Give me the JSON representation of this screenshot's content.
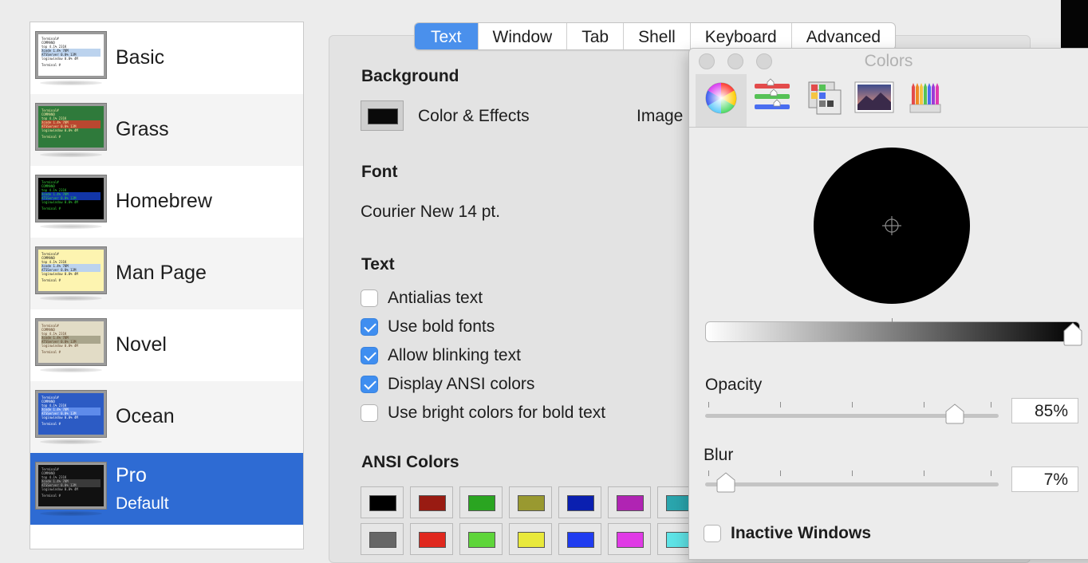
{
  "profiles": [
    {
      "name": "Basic",
      "sub": "",
      "thumb_bg": "#ffffff",
      "thumb_fg": "#222222",
      "band": "#bcd3ee",
      "band2": "#ffffff"
    },
    {
      "name": "Grass",
      "sub": "",
      "thumb_bg": "#2f7a3b",
      "thumb_fg": "#f2e9a8",
      "band": "#b94730",
      "band2": "#2f7a3b"
    },
    {
      "name": "Homebrew",
      "sub": "",
      "thumb_bg": "#000000",
      "thumb_fg": "#37d43a",
      "band": "#1236a8",
      "band2": "#000000"
    },
    {
      "name": "Man Page",
      "sub": "",
      "thumb_bg": "#fdf4b0",
      "thumb_fg": "#222222",
      "band": "#bcd3ee",
      "band2": "#fdf4b0"
    },
    {
      "name": "Novel",
      "sub": "",
      "thumb_bg": "#e2dcc6",
      "thumb_fg": "#5a3b22",
      "band": "#a9a58c",
      "band2": "#e2dcc6"
    },
    {
      "name": "Ocean",
      "sub": "",
      "thumb_bg": "#2c5bc4",
      "thumb_fg": "#ffffff",
      "band": "#5e8bea",
      "band2": "#2c5bc4"
    },
    {
      "name": "Pro",
      "sub": "Default",
      "thumb_bg": "#111111",
      "thumb_fg": "#bdbdbd",
      "band": "#3a3a3a",
      "band2": "#111111"
    }
  ],
  "thumb_text": {
    "line1": "Terminal#",
    "line2": "COMMAND",
    "line3": "top      4.1%   231K",
    "line4": "Xcode    1.4%   78M",
    "line5": "ATSServer 0.0%  13M",
    "line6": "loginwindow 0.0%  4M",
    "prompt": "Terminal #"
  },
  "tabs": [
    "Text",
    "Window",
    "Tab",
    "Shell",
    "Keyboard",
    "Advanced"
  ],
  "active_tab": "Text",
  "settings": {
    "background_title": "Background",
    "color_effects_label": "Color & Effects",
    "image_label": "Image",
    "font_title": "Font",
    "font_value": "Courier New 14 pt.",
    "text_title": "Text",
    "checkboxes": [
      {
        "label": "Antialias text",
        "checked": false
      },
      {
        "label": "Use bold fonts",
        "checked": true
      },
      {
        "label": "Allow blinking text",
        "checked": true
      },
      {
        "label": "Display ANSI colors",
        "checked": true
      },
      {
        "label": "Use bright colors for bold text",
        "checked": false
      }
    ],
    "ansi_title": "ANSI Colors",
    "ansi_row1": [
      "#000000",
      "#991b12",
      "#2aa521",
      "#999930",
      "#0a1fb0",
      "#b024b3",
      "#2aa5ad"
    ],
    "ansi_row2": [
      "#666666",
      "#e0281e",
      "#5ed53a",
      "#e9e93b",
      "#1f3cf0",
      "#e03ae6",
      "#5ee3e6"
    ]
  },
  "colors_panel": {
    "title": "Colors",
    "modes": [
      "color-wheel",
      "color-sliders",
      "color-palettes",
      "image-palettes",
      "pencils"
    ],
    "selected_color": "#000000",
    "opacity_label": "Opacity",
    "opacity_value": "85%",
    "opacity_fraction": 0.85,
    "blur_label": "Blur",
    "blur_value": "7%",
    "blur_fraction": 0.07,
    "inactive_label": "Inactive Windows",
    "inactive_checked": false
  }
}
